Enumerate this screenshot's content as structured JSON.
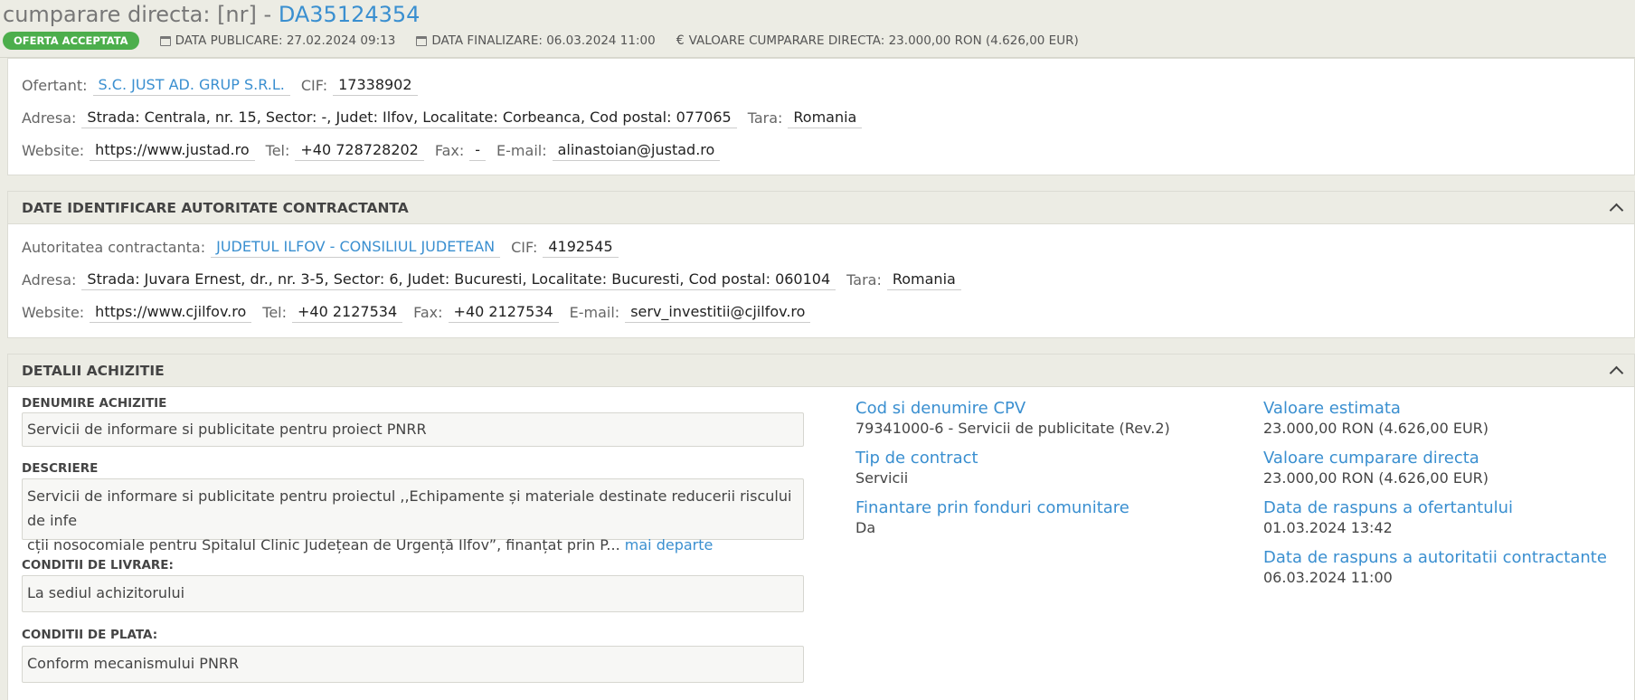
{
  "header": {
    "title_prefix": "cumparare directa: [nr] -",
    "title_code": "DA35124354",
    "status_badge": "OFERTA ACCEPTATA",
    "data_publicare": "DATA PUBLICARE: 27.02.2024 09:13",
    "data_finalizare": "DATA FINALIZARE: 06.03.2024 11:00",
    "valoare": "VALOARE CUMPARARE DIRECTA: 23.000,00  RON (4.626,00  EUR)"
  },
  "ofertant": {
    "label_ofertant": "Ofertant:",
    "name": "S.C. JUST AD. GRUP S.R.L.",
    "label_cif": "CIF:",
    "cif": "17338902",
    "label_adresa": "Adresa:",
    "adresa": "Strada: Centrala, nr. 15, Sector: -, Judet: Ilfov, Localitate: Corbeanca, Cod postal: 077065",
    "label_tara": "Tara:",
    "tara": "Romania",
    "label_website": "Website:",
    "website": "https://www.justad.ro",
    "label_tel": "Tel:",
    "tel": "+40 728728202",
    "label_fax": "Fax:",
    "fax": "-",
    "label_email": "E-mail:",
    "email": "alinastoian@justad.ro"
  },
  "autoritate": {
    "section_title": "DATE IDENTIFICARE AUTORITATE CONTRACTANTA",
    "label_autoritate": "Autoritatea contractanta:",
    "name": "JUDETUL ILFOV - CONSILIUL JUDETEAN",
    "label_cif": "CIF:",
    "cif": "4192545",
    "label_adresa": "Adresa:",
    "adresa": "Strada: Juvara Ernest, dr., nr. 3-5, Sector: 6, Judet: Bucuresti, Localitate: Bucuresti, Cod postal: 060104",
    "label_tara": "Tara:",
    "tara": "Romania",
    "label_website": "Website:",
    "website": "https://www.cjilfov.ro",
    "label_tel": "Tel:",
    "tel": "+40 2127534",
    "label_fax": "Fax:",
    "fax": "+40 2127534",
    "label_email": "E-mail:",
    "email": "serv_investitii@cjilfov.ro"
  },
  "detalii": {
    "section_title": "DETALII ACHIZITIE",
    "denumire_label": "DENUMIRE ACHIZITIE",
    "denumire": "Servicii de informare si publicitate pentru proiect PNRR",
    "descriere_label": "DESCRIERE",
    "descriere_line1": "Servicii de informare si publicitate pentru proiectul ,,Echipamente și materiale destinate reducerii riscului de infe",
    "descriere_line2": "cții nosocomiale pentru Spitalul Clinic Județean de Urgență Ilfov”, finanțat prin P...",
    "mai_departe": "mai departe",
    "livrare_label": "CONDITII DE LIVRARE:",
    "livrare": "La sediul achizitorului",
    "plata_label": "CONDITII DE PLATA:",
    "plata": "Conform mecanismului PNRR",
    "cpv_title": "Cod si denumire CPV",
    "cpv": "79341000-6 - Servicii de publicitate (Rev.2)",
    "tip_title": "Tip de contract",
    "tip": "Servicii",
    "fonduri_title": "Finantare prin fonduri comunitare",
    "fonduri": "Da",
    "val_estimata_title": "Valoare estimata",
    "val_estimata": "23.000,00  RON (4.626,00  EUR)",
    "val_directa_title": "Valoare cumparare directa",
    "val_directa": "23.000,00  RON (4.626,00  EUR)",
    "raspuns_ofertant_title": "Data de raspuns a ofertantului",
    "raspuns_ofertant": "01.03.2024 13:42",
    "raspuns_autoritate_title": "Data de raspuns a autoritatii contractante",
    "raspuns_autoritate": "06.03.2024 11:00"
  }
}
